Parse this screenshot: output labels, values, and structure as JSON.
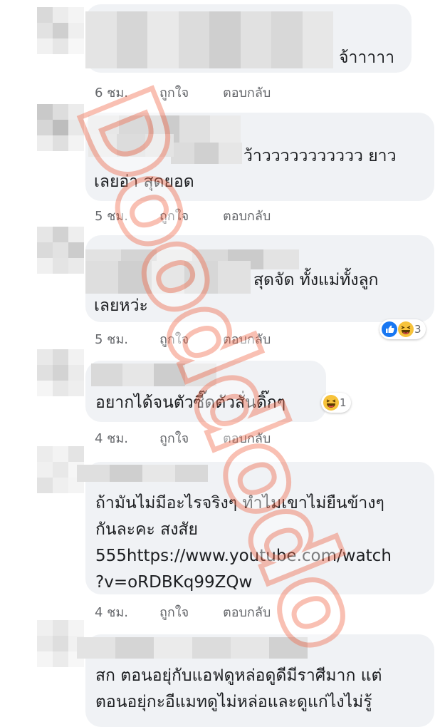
{
  "comments": [
    {
      "text_lines": [
        "จ้าาาาา"
      ],
      "time": "6 ชม.",
      "like": "ถูกใจ",
      "reply": "ตอบกลับ"
    },
    {
      "text_lines": [
        "ว้าววววววววววว ยาว",
        "เลยอ่า สุดยอด"
      ],
      "time": "5 ชม.",
      "like": "ถูกใจ",
      "reply": "ตอบกลับ"
    },
    {
      "text_lines": [
        "สุดจัด ทั้งแม่ทั้งลูก",
        "เลยหว่ะ"
      ],
      "time": "5 ชม.",
      "like": "ถูกใจ",
      "reply": "ตอบกลับ",
      "reactions": {
        "icons": [
          "like-icon",
          "haha-icon"
        ],
        "count": "3"
      }
    },
    {
      "text_lines": [
        "อยากได้จนตัวซี๊ดตัวสั่นดิ๊กๆ"
      ],
      "time": "4 ชม.",
      "like": "ถูกใจ",
      "reply": "ตอบกลับ",
      "reactions": {
        "icons": [
          "haha-icon"
        ],
        "count": "1"
      }
    },
    {
      "text_lines": [
        "ถ้ามันไม่มีอะไรจริงๆ ทำไมเขาไม่ยืนข้างๆ",
        "กันละคะ สงสัย",
        "555https://www.youtube.com/watch",
        "?v=oRDBKq99ZQw"
      ],
      "time": "4 ชม.",
      "like": "ถูกใจ",
      "reply": "ตอบกลับ"
    },
    {
      "text_lines": [
        "สก ตอนอยุ่กับแอฟดูหล่อดูดีมีราศีมาก แต่",
        "ตอนอยุ่กะอีแมทดูไม่หล่อและดูแก่ไงไม่รู้"
      ]
    }
  ],
  "watermark": "Dooddodo",
  "colors": {
    "bubble": "#f0f2f5",
    "meta": "#65676b",
    "like": "#1877f2",
    "haha": "#f7c33b",
    "watermark": "#f26a4b"
  }
}
